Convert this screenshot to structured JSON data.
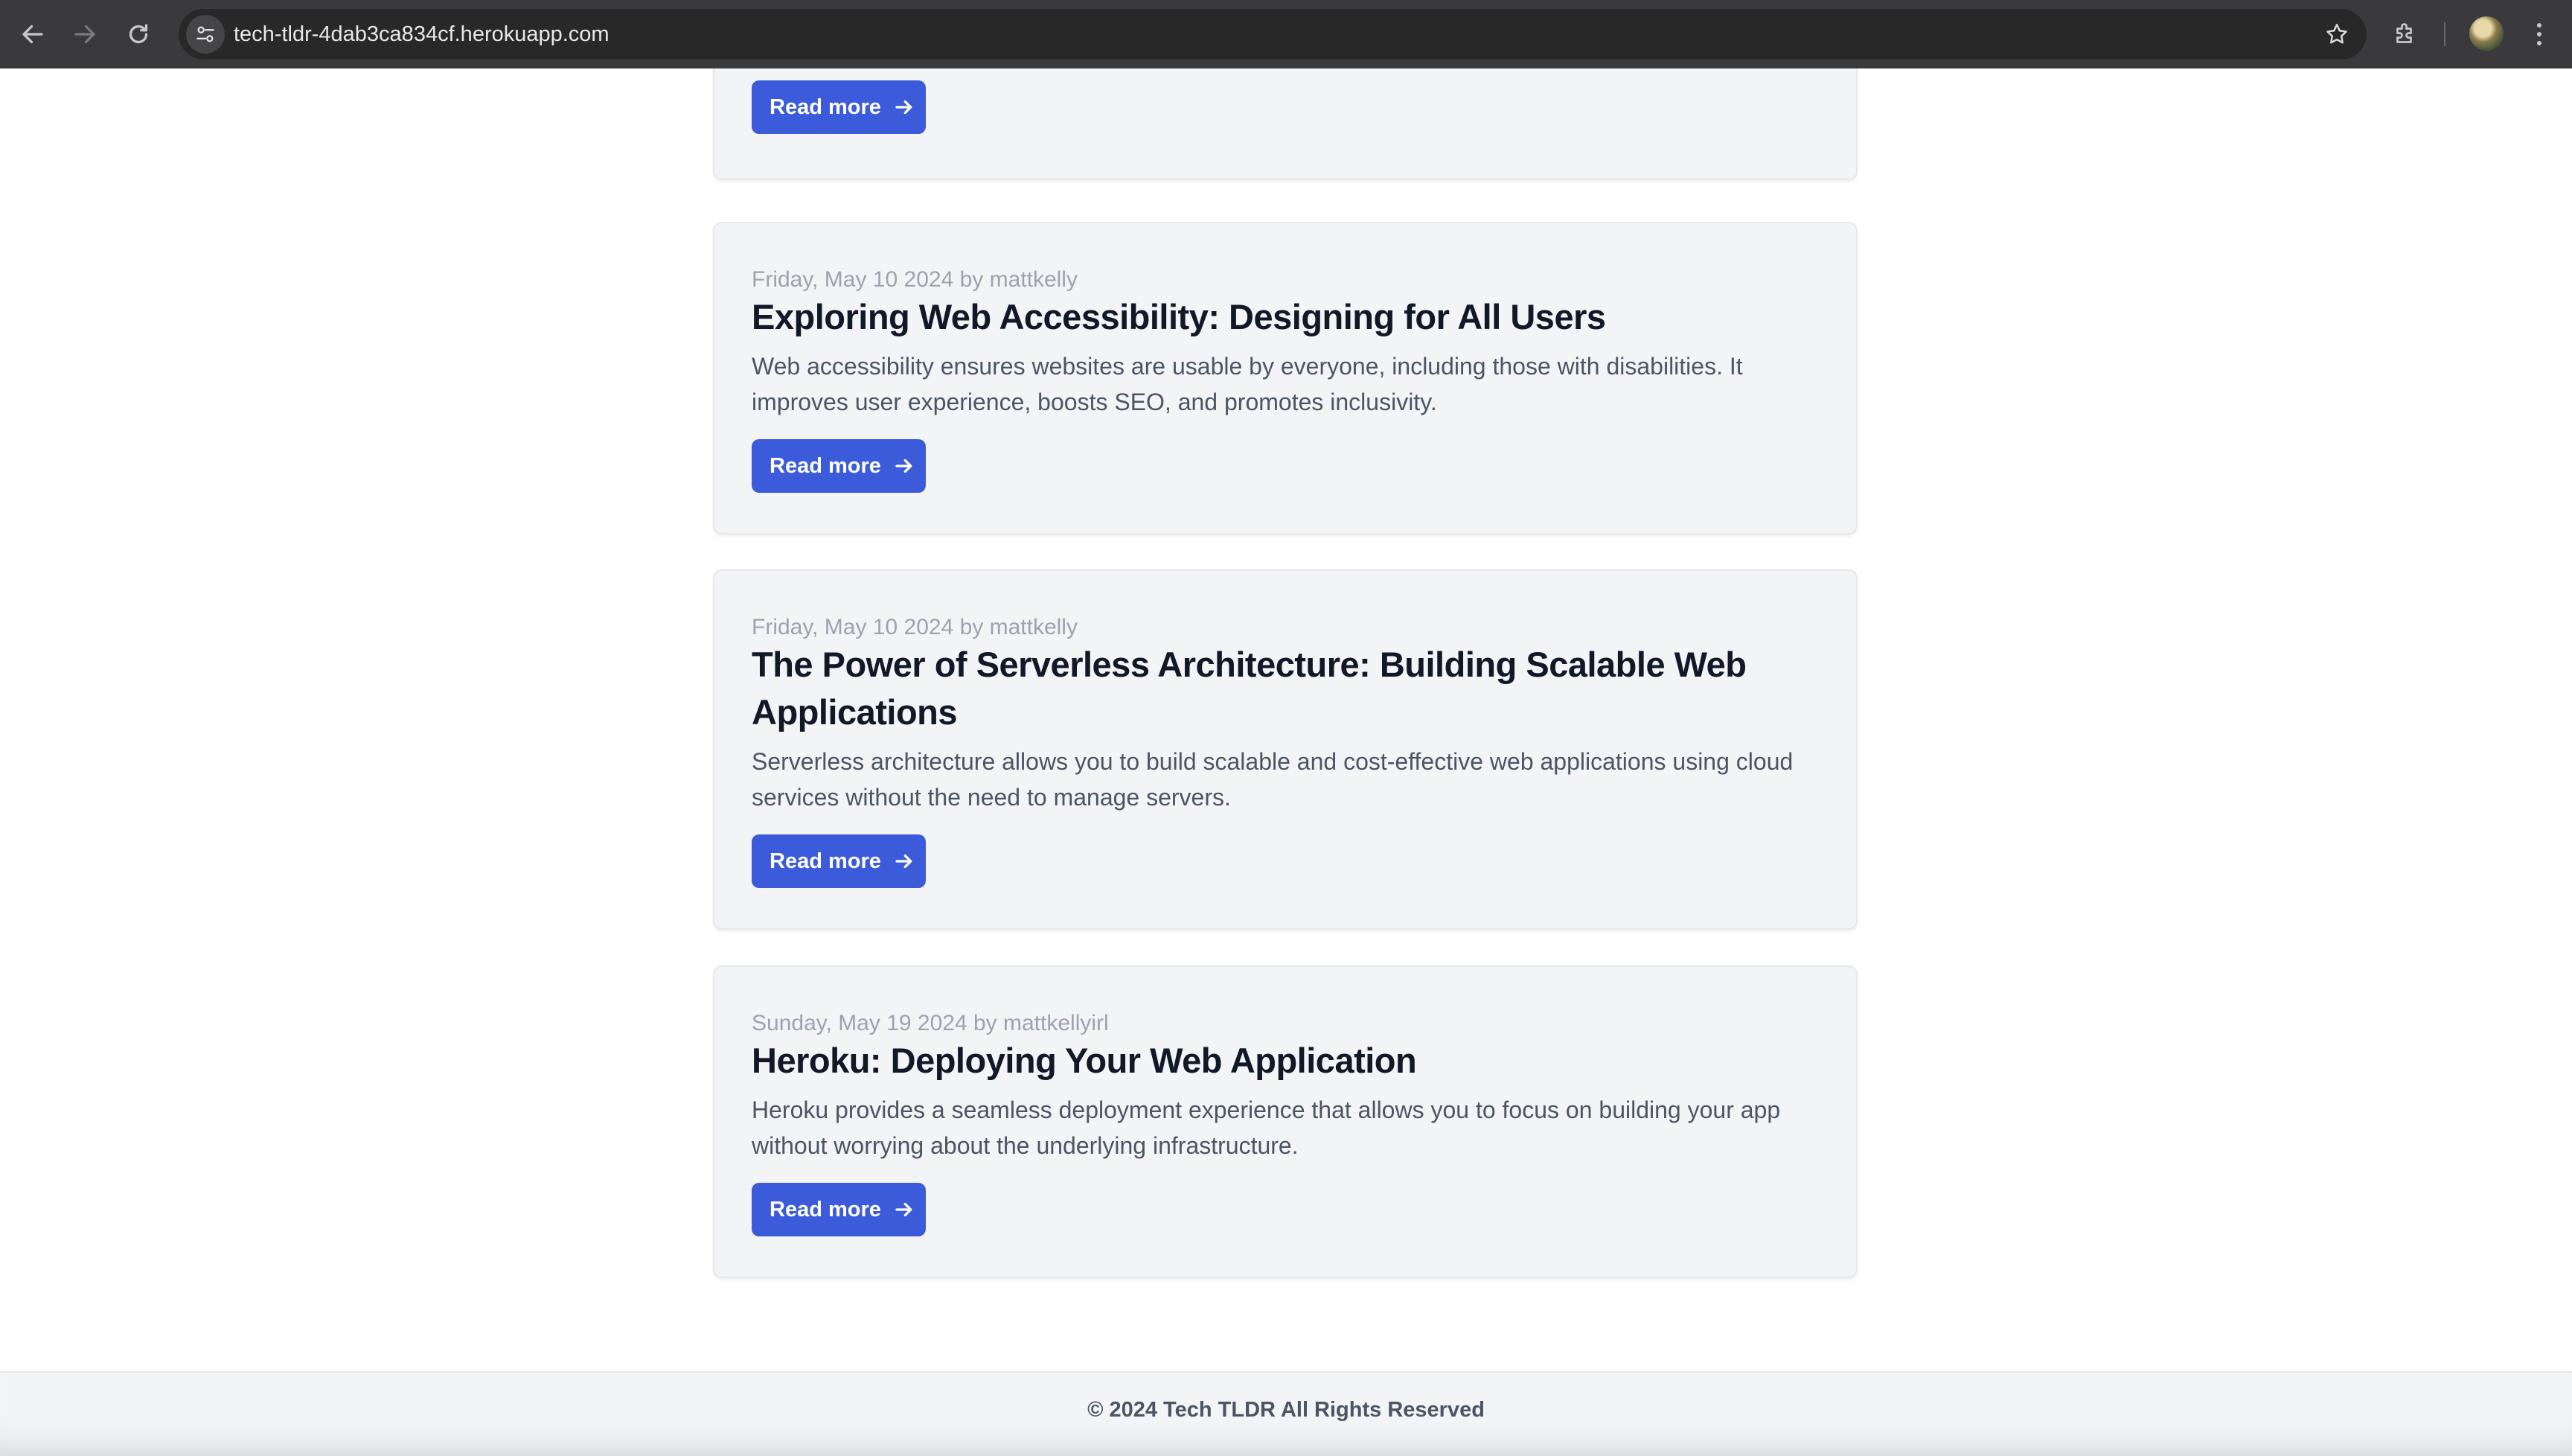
{
  "browser": {
    "url": "tech-tldr-4dab3ca834cf.herokuapp.com",
    "icons": {
      "back": "arrow-left-icon",
      "forward": "arrow-right-icon",
      "reload": "reload-icon",
      "site_info": "tune-icon",
      "bookmark": "star-icon",
      "extensions": "puzzle-icon",
      "profile": "avatar",
      "menu": "kebab-menu-icon"
    }
  },
  "posts": [
    {
      "meta": "",
      "title": "",
      "excerpt": "",
      "read_more_label": "Read more"
    },
    {
      "meta": "Friday, May 10 2024 by mattkelly",
      "title": "Exploring Web Accessibility: Designing for All Users",
      "excerpt": "Web accessibility ensures websites are usable by everyone, including those with disabilities. It improves user experience, boosts SEO, and promotes inclusivity.",
      "read_more_label": "Read more"
    },
    {
      "meta": "Friday, May 10 2024 by mattkelly",
      "title": "The Power of Serverless Architecture: Building Scalable Web Applications",
      "excerpt": "Serverless architecture allows you to build scalable and cost-effective web applications using cloud services without the need to manage servers.",
      "read_more_label": "Read more"
    },
    {
      "meta": "Sunday, May 19 2024 by mattkellyirl",
      "title": "Heroku: Deploying Your Web Application",
      "excerpt": "Heroku provides a seamless deployment experience that allows you to focus on building your app without worrying about the underlying infrastructure.",
      "read_more_label": "Read more"
    }
  ],
  "footer": {
    "text": "© 2024 Tech TLDR All Rights Reserved"
  },
  "colors": {
    "accent": "#3b5bdb",
    "card_bg": "#f3f4f6",
    "title": "#111827",
    "meta": "#9ca3af",
    "body": "#4b5563",
    "chrome_bg": "#3a3a3c"
  }
}
